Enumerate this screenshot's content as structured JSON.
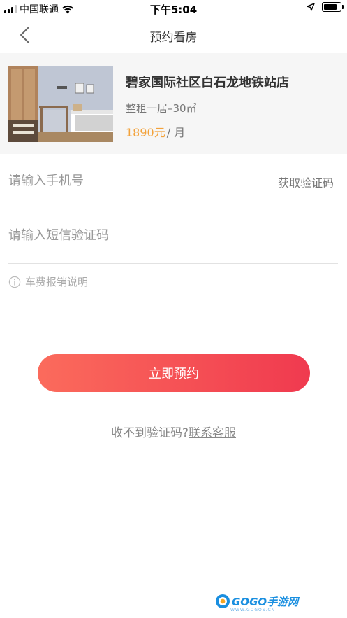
{
  "status_bar": {
    "carrier": "中国联通",
    "time": "下午5:04"
  },
  "nav": {
    "title": "预约看房",
    "back_icon": "chevron-left-icon"
  },
  "listing": {
    "name": "碧家国际社区白石龙地铁站店",
    "spec": "整租一居–30㎡",
    "price": "1890元",
    "unit": "/ 月",
    "price_color": "#f3a23a"
  },
  "form": {
    "phone_placeholder": "请输入手机号",
    "get_code_label": "获取验证码",
    "code_placeholder": "请输入短信验证码",
    "fee_note": "车费报销说明"
  },
  "submit": {
    "label": "立即预约",
    "gradient": [
      "#fb6b5c",
      "#f03a4f"
    ]
  },
  "help": {
    "text": "收不到验证码?",
    "link": "联系客服"
  },
  "watermark": {
    "brand": "GOGO手游网",
    "url": "WWW.GOGOS.CN"
  }
}
